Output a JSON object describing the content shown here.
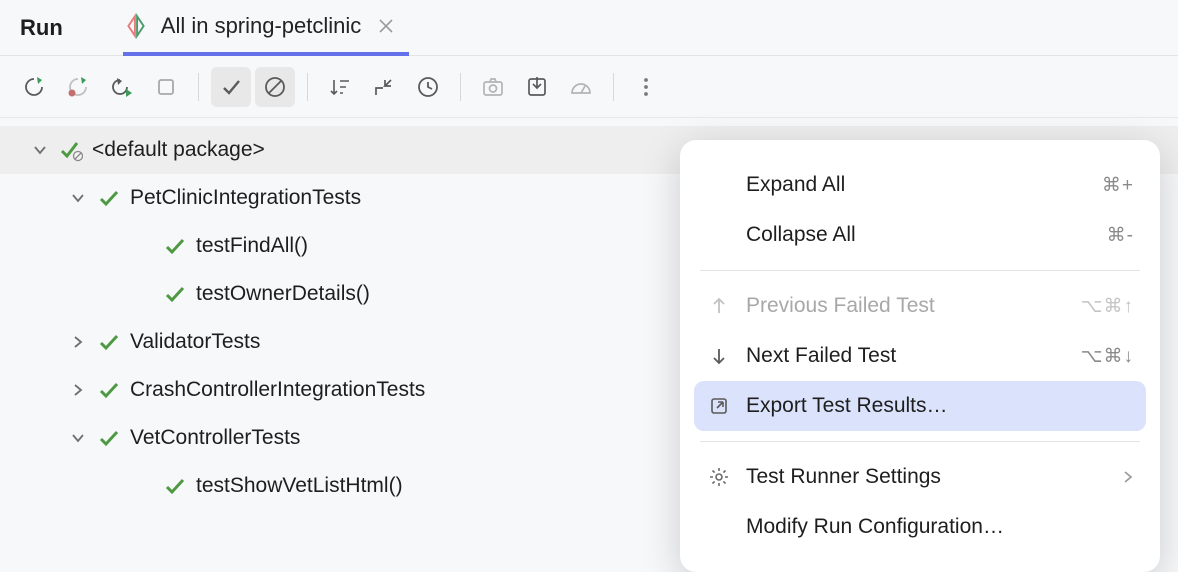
{
  "header": {
    "run_label": "Run",
    "tab_title": "All in spring-petclinic"
  },
  "tree": {
    "root": {
      "label": "<default package>"
    },
    "petclinic": {
      "label": "PetClinicIntegrationTests"
    },
    "tests": {
      "find_all": "testFindAll()",
      "owner_details": "testOwnerDetails()"
    },
    "validator": {
      "label": "ValidatorTests"
    },
    "crash": {
      "label": "CrashControllerIntegrationTests"
    },
    "vet": {
      "label": "VetControllerTests"
    },
    "vet_test": "testShowVetListHtml()"
  },
  "menu": {
    "expand_all": "Expand All",
    "collapse_all": "Collapse All",
    "prev_failed": "Previous Failed Test",
    "next_failed": "Next Failed Test",
    "export": "Export Test Results…",
    "settings": "Test Runner Settings",
    "modify": "Modify Run Configuration…",
    "sc_expand": "⌘+",
    "sc_collapse": "⌘-",
    "sc_prev": "⌥⌘↑",
    "sc_next": "⌥⌘↓"
  }
}
